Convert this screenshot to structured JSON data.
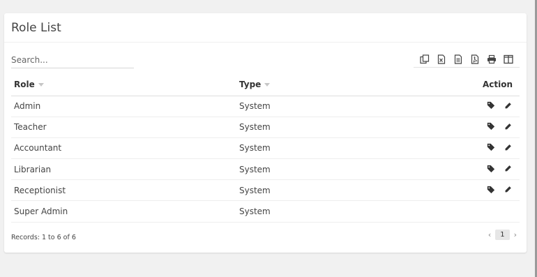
{
  "box": {
    "title": "Role List"
  },
  "search": {
    "placeholder": "Search..."
  },
  "toolbar": {
    "tools": [
      "copy-icon",
      "excel-icon",
      "csv-icon",
      "pdf-icon",
      "print-icon",
      "columns-icon"
    ]
  },
  "table": {
    "headers": {
      "role": "Role",
      "type": "Type",
      "action": "Action"
    },
    "rows": [
      {
        "role": "Admin",
        "type": "System",
        "actions": [
          "tag-icon",
          "edit-icon"
        ]
      },
      {
        "role": "Teacher",
        "type": "System",
        "actions": [
          "tag-icon",
          "edit-icon"
        ]
      },
      {
        "role": "Accountant",
        "type": "System",
        "actions": [
          "tag-icon",
          "edit-icon"
        ]
      },
      {
        "role": "Librarian",
        "type": "System",
        "actions": [
          "tag-icon",
          "edit-icon"
        ]
      },
      {
        "role": "Receptionist",
        "type": "System",
        "actions": [
          "tag-icon",
          "edit-icon"
        ]
      },
      {
        "role": "Super Admin",
        "type": "System",
        "actions": []
      }
    ]
  },
  "footer": {
    "records": "Records: 1 to 6 of 6",
    "prev": "‹",
    "page": "1",
    "next": "›"
  }
}
